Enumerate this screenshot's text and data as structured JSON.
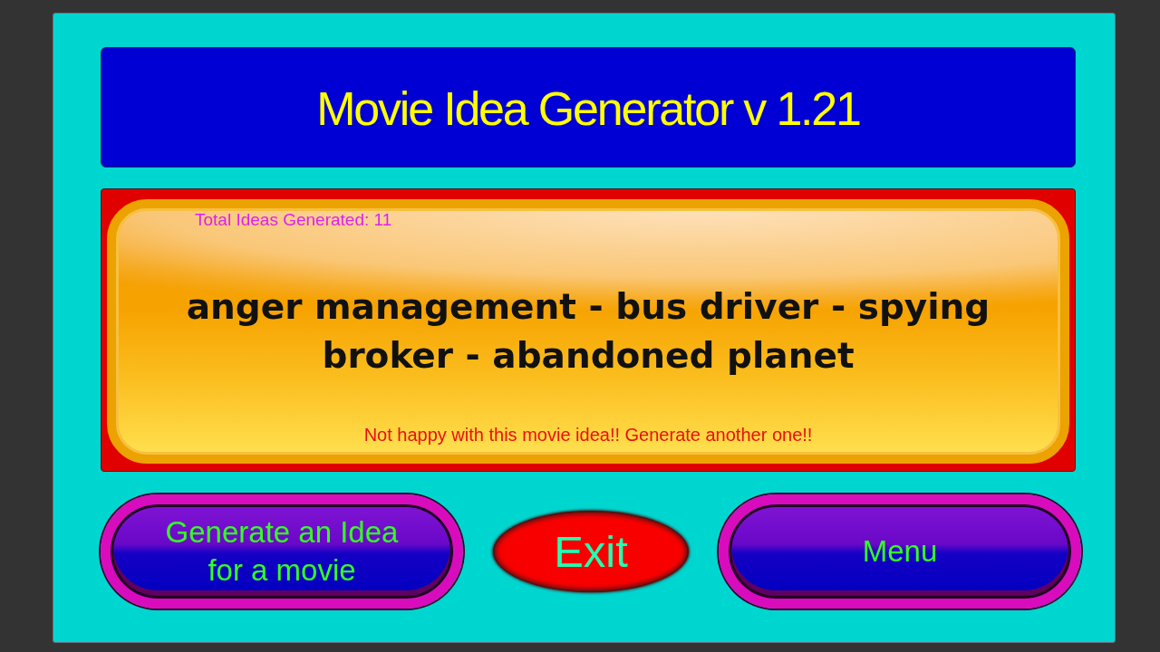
{
  "title": "Movie Idea Generator v 1.21",
  "idea_panel": {
    "counter": "Total Ideas Generated: 11",
    "idea": "anger management - bus driver - spying broker - abandoned planet",
    "hint": "Not happy with this movie idea!! Generate another one!!"
  },
  "buttons": [
    {
      "label": "Generate an Idea for a movie",
      "kind": "pill"
    },
    {
      "label": "Exit",
      "kind": "oval"
    },
    {
      "label": "Menu",
      "kind": "pill"
    }
  ]
}
